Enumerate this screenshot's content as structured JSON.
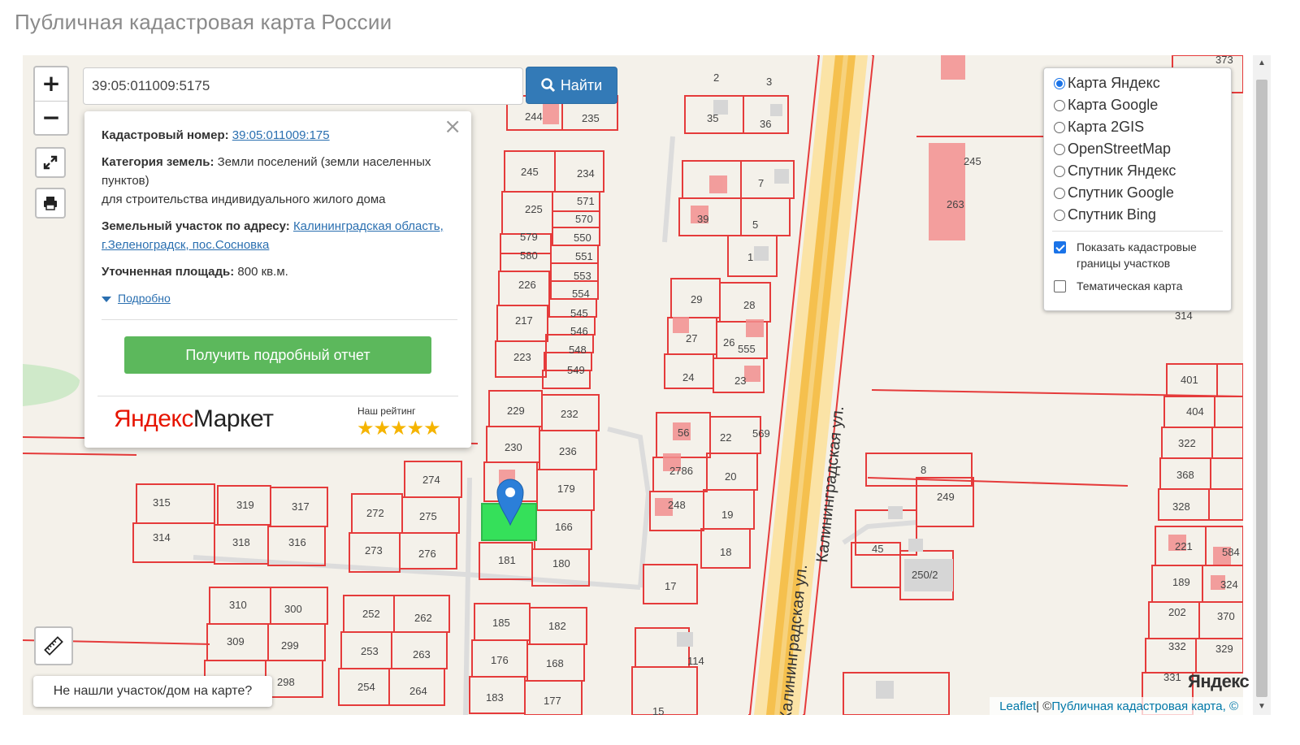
{
  "page_title": "Публичная кадастровая карта России",
  "search": {
    "value": "39:05:011009:5175",
    "button_label": "Найти"
  },
  "zoom": {
    "plus": "+",
    "minus": "−"
  },
  "popup": {
    "cadastral_label": "Кадастровый номер:",
    "cadastral_number": "39:05:011009:175",
    "category_label": "Категория земель:",
    "category_value_1": "Земли поселений (земли населенных пунктов)",
    "category_value_2": "для строительства индивидуального жилого дома",
    "address_label": "Земельный участок по адресу:",
    "address_value": "Калининградская область, г.Зеленоградск, пос.Сосновка",
    "area_label": "Уточненная площадь:",
    "area_value": "800 кв.м.",
    "more_label": "Подробно",
    "report_button": "Получить подробный отчет",
    "market_logo_y": "Яндекс",
    "market_logo_m": "Маркет",
    "rating_label": "Наш рейтинг",
    "stars": "★★★★★",
    "close": "×"
  },
  "layers": {
    "options": [
      {
        "label": "Карта Яндекс",
        "selected": true
      },
      {
        "label": "Карта Google",
        "selected": false
      },
      {
        "label": "Карта 2GIS",
        "selected": false
      },
      {
        "label": "OpenStreetMap",
        "selected": false
      },
      {
        "label": "Спутник Яндекс",
        "selected": false
      },
      {
        "label": "Спутник Google",
        "selected": false
      },
      {
        "label": "Спутник Bing",
        "selected": false
      }
    ],
    "checkbox_boundaries": "Показать кадастровые границы участков",
    "checkbox_thematic": "Тематическая карта"
  },
  "not_found_label": "Не нашли участок/дом на карте?",
  "attribution": {
    "leaflet": "Leaflet",
    "sep": " | © ",
    "pkk": "Публичная кадастровая карта, ©"
  },
  "yandex_watermark": "Яндекс",
  "street_label": "Калининградская ул.",
  "street_label_2": "Калининградская ул.",
  "parcel_labels": [
    "244",
    "235",
    "245",
    "234",
    "571",
    "225",
    "570",
    "579",
    "550",
    "580",
    "551",
    "553",
    "226",
    "554",
    "545",
    "217",
    "546",
    "548",
    "223",
    "549",
    "229",
    "232",
    "230",
    "236",
    "179",
    "166",
    "181",
    "180",
    "274",
    "275",
    "272",
    "276",
    "273",
    "319",
    "317",
    "315",
    "318",
    "316",
    "314",
    "310",
    "300",
    "309",
    "299",
    "298",
    "252",
    "262",
    "253",
    "263",
    "254",
    "264",
    "185",
    "182",
    "176",
    "168",
    "183",
    "177",
    "35",
    "36",
    "7",
    "39",
    "5",
    "29",
    "28",
    "27",
    "26",
    "555",
    "24",
    "23",
    "56",
    "22",
    "569",
    "2786",
    "20",
    "248",
    "19",
    "18",
    "17",
    "114",
    "245",
    "263",
    "8",
    "249",
    "45",
    "250/2",
    "401",
    "404",
    "322",
    "368",
    "328",
    "221",
    "189",
    "202",
    "332",
    "331",
    "314",
    "373",
    "2",
    "3",
    "1",
    "584",
    "324",
    "370",
    "329",
    "15"
  ],
  "colors": {
    "parcel_stroke": "#e53b3b",
    "building_fill": "#f28f8f",
    "selected_parcel": "#35e05a",
    "road_fill": "#f5c04e",
    "search_button": "#337ab7",
    "report_button": "#5cb85c",
    "marker": "#2b7fd9"
  },
  "icons": {
    "fullscreen": "expand-icon",
    "print": "print-icon",
    "ruler": "ruler-icon",
    "search": "search-icon",
    "marker": "map-marker-icon"
  }
}
